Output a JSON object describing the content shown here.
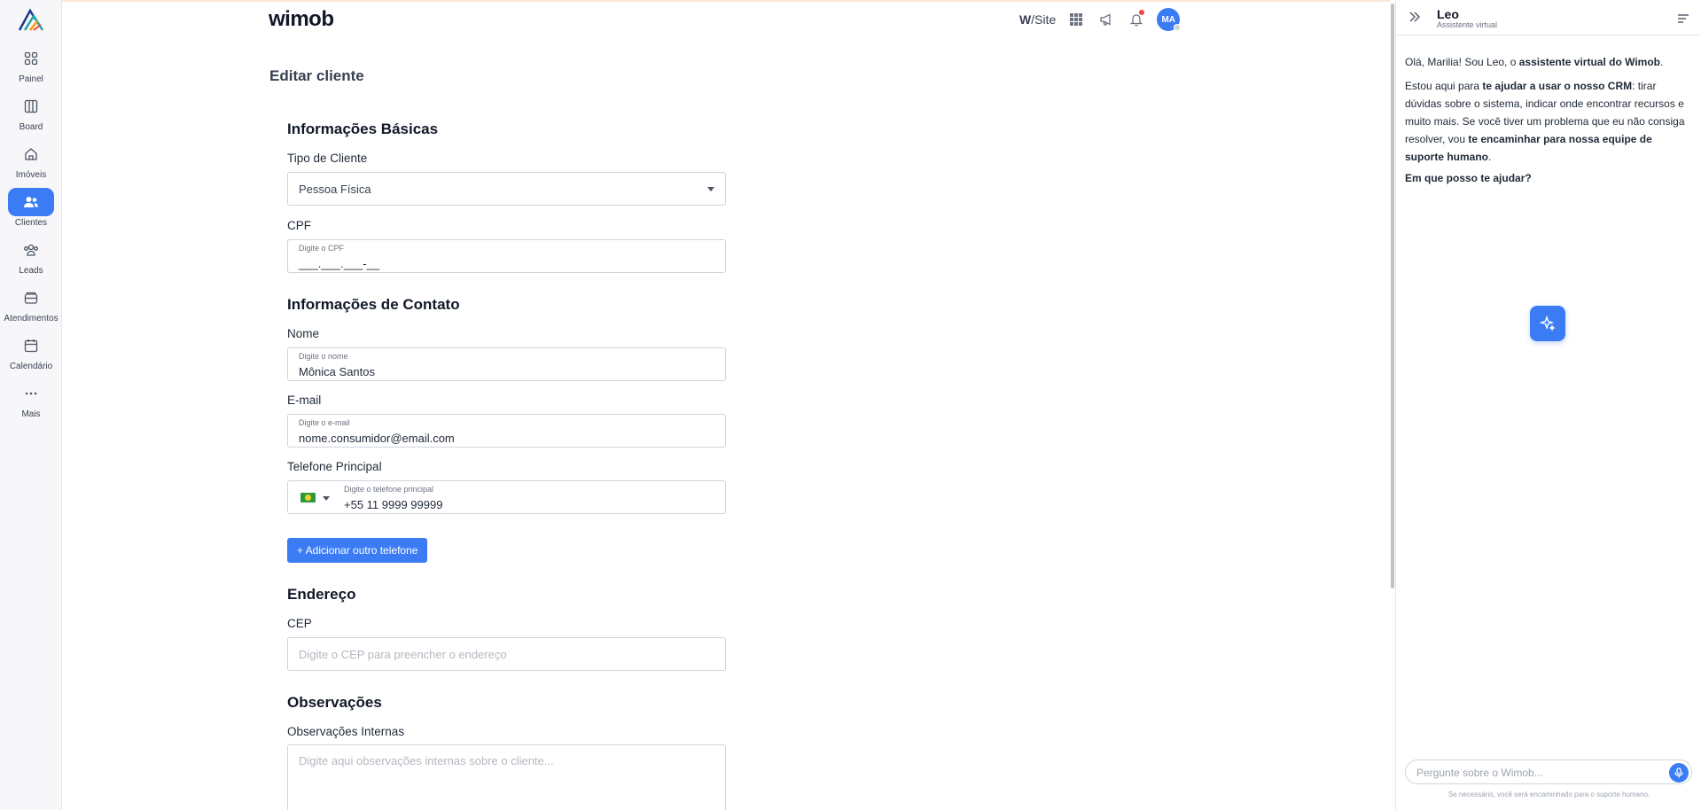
{
  "nav": {
    "items": [
      {
        "label": "Painel",
        "icon": "dashboard-icon"
      },
      {
        "label": "Board",
        "icon": "board-icon"
      },
      {
        "label": "Imóveis",
        "icon": "home-icon"
      },
      {
        "label": "Clientes",
        "icon": "users-icon"
      },
      {
        "label": "Leads",
        "icon": "leads-icon"
      },
      {
        "label": "Atendimentos",
        "icon": "inbox-icon"
      },
      {
        "label": "Calendário",
        "icon": "calendar-icon"
      },
      {
        "label": "Mais",
        "icon": "more-icon"
      }
    ],
    "active": "Clientes"
  },
  "header": {
    "brand": "wimob",
    "wsite_prefix": "W",
    "wsite_suffix": "/Site",
    "avatar_initials": "MA"
  },
  "page": {
    "title": "Editar cliente"
  },
  "form": {
    "basic": {
      "title": "Informações Básicas",
      "tipo_label": "Tipo de Cliente",
      "tipo_value": "Pessoa Física",
      "cpf_label": "CPF",
      "cpf_hint": "Digite o CPF",
      "cpf_value": "___.___.___-__"
    },
    "contact": {
      "title": "Informações de Contato",
      "nome_label": "Nome",
      "nome_hint": "Digite o nome",
      "nome_value": "Mônica Santos",
      "email_label": "E-mail",
      "email_hint": "Digite o e-mail",
      "email_value": "nome.consumidor@email.com",
      "phone_label": "Telefone Principal",
      "phone_hint": "Digite o telefone principal",
      "phone_value": "+55 11 9999 99999",
      "add_phone": "+ Adicionar outro telefone"
    },
    "address": {
      "title": "Endereço",
      "cep_label": "CEP",
      "cep_placeholder": "Digite o CEP para preencher o endereço"
    },
    "notes": {
      "title": "Observações",
      "label": "Observações Internas",
      "placeholder": "Digite aqui observações internas sobre o cliente..."
    }
  },
  "assistant": {
    "name": "Leo",
    "subtitle": "Assistente virtual",
    "greeting_a": "Olá, Marilia! Sou Leo, o ",
    "greeting_b": "assistente virtual do Wimob",
    "greeting_c": ".",
    "help_a": "Estou aqui para ",
    "help_b": "te ajudar a usar o nosso CRM",
    "help_c": ": tirar dúvidas sobre o sistema, indicar onde encontrar recursos e muito mais. Se você tiver um problema que eu não consiga resolver, vou ",
    "help_d": "te encaminhar para nossa equipe de suporte humano",
    "help_e": ".",
    "question": "Em que posso te ajudar?",
    "input_placeholder": "Pergunte sobre o Wimob...",
    "footer": "Se necessário, você será encaminhado para o suporte humano."
  },
  "colors": {
    "accent": "#3b7cf4",
    "notification": "#ef4444"
  }
}
